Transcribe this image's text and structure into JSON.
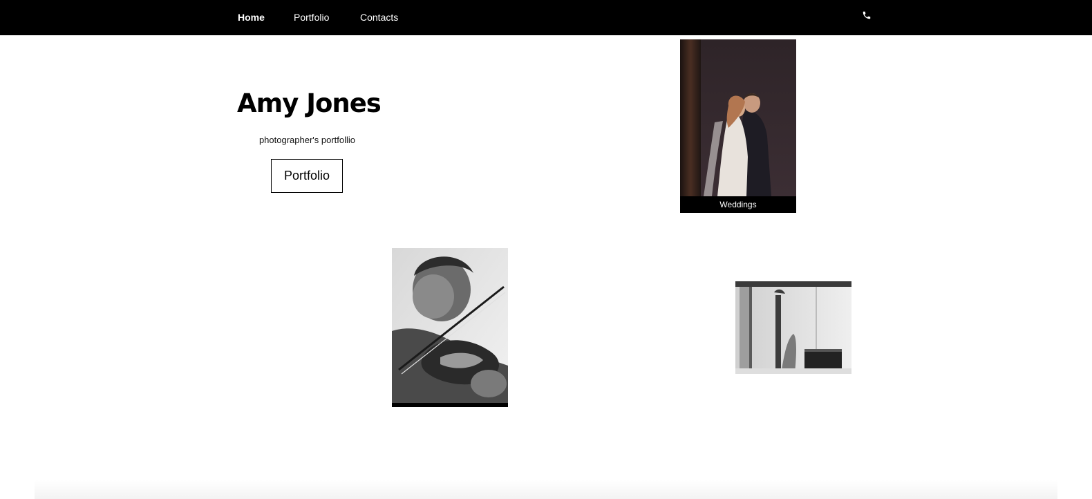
{
  "nav": {
    "items": [
      {
        "label": "Home",
        "active": true
      },
      {
        "label": "Portfolio",
        "active": false
      },
      {
        "label": "Contacts",
        "active": false
      }
    ],
    "phone_icon": "phone-icon"
  },
  "hero": {
    "title": "Amy Jones",
    "subtitle": "photographer's portfollio",
    "button_label": "Portfolio"
  },
  "gallery": {
    "weddings_caption": "Weddings"
  },
  "colors": {
    "nav_background": "#000000",
    "page_background": "#ffffff",
    "text": "#000000"
  }
}
